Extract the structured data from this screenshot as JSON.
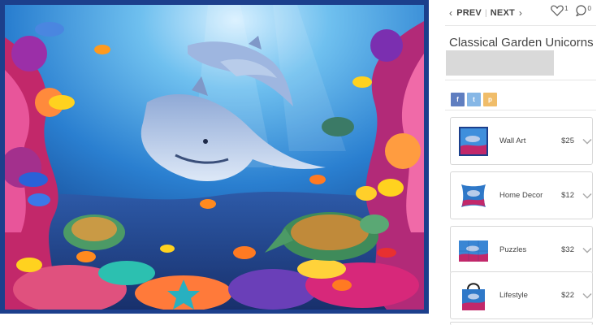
{
  "nav": {
    "prev_label": "PREV",
    "separator": "|",
    "next_label": "NEXT",
    "prev_icon": "chevron-left-icon",
    "next_icon": "chevron-right-icon"
  },
  "social": {
    "like_count": "1",
    "comment_count": "0",
    "like_icon": "heart-icon",
    "comment_icon": "comment-icon"
  },
  "artwork": {
    "title": "Classical Garden Unicorns"
  },
  "share": {
    "facebook": "f",
    "twitter": "t",
    "pinterest": "p"
  },
  "products": [
    {
      "name": "Wall Art",
      "price": "$25",
      "icon": "framed-print-thumbnail"
    },
    {
      "name": "Home Decor",
      "price": "$12",
      "icon": "pillow-thumbnail"
    },
    {
      "name": "Puzzles",
      "price": "$32",
      "icon": "puzzle-thumbnail"
    },
    {
      "name": "Lifestyle",
      "price": "$22",
      "icon": "tote-bag-thumbnail"
    }
  ],
  "colors": {
    "frame": "#1c3f8c",
    "facebook": "#5f7ec0",
    "twitter": "#86b7e6",
    "pinterest": "#f0bd6a"
  }
}
